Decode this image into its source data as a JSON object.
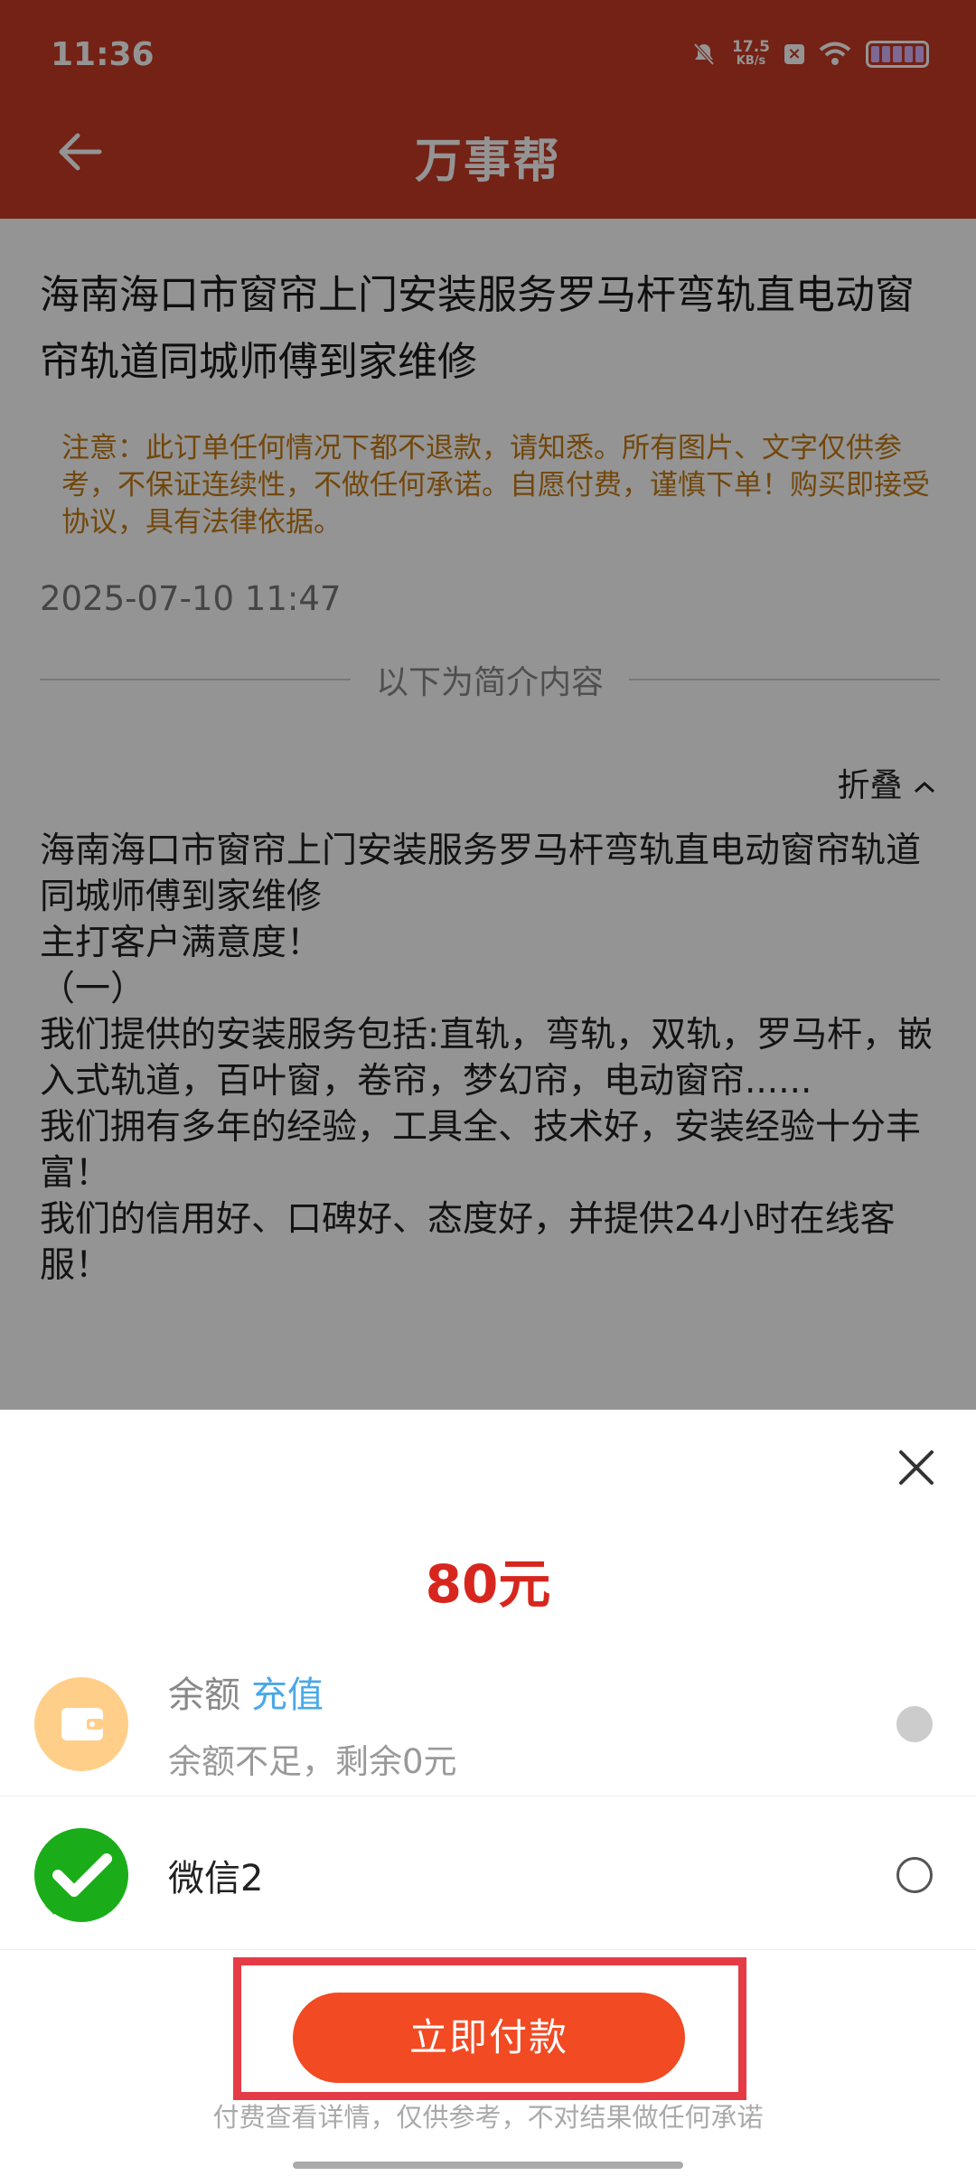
{
  "status": {
    "time": "11:36",
    "speed": "17.5",
    "speed_unit": "KB/s"
  },
  "header": {
    "title": "万事帮"
  },
  "article": {
    "title": "海南海口市窗帘上门安装服务罗马杆弯轨直电动窗帘轨道同城师傅到家维修",
    "notice": "注意：此订单任何情况下都不退款，请知悉。所有图片、文字仅供参考，不保证连续性，不做任何承诺。自愿付费，谨慎下单！购买即接受协议，具有法律依据。",
    "date": "2025-07-10 11:47",
    "divider_text": "以下为简介内容",
    "fold_label": "折叠",
    "description": "海南海口市窗帘上门安装服务罗马杆弯轨直电动窗帘轨道同城师傅到家维修\n主打客户满意度！\n（一）\n我们提供的安装服务包括:直轨，弯轨，双轨，罗马杆，嵌入式轨道，百叶窗，卷帘，梦幻帘，电动窗帘......\n我们拥有多年的经验，工具全、技术好，安装经验十分丰富！\n我们的信用好、口碑好、态度好，并提供24小时在线客服！"
  },
  "payment": {
    "price": "80元",
    "balance": {
      "label": "余额",
      "recharge": "充值",
      "sub": "余额不足，剩余0元"
    },
    "wechat": {
      "label": "微信2"
    },
    "pay_button": "立即付款",
    "footnote": "付费查看详情，仅供参考，不对结果做任何承诺"
  },
  "colors": {
    "brand": "#c63b25",
    "price": "#d7261d",
    "button": "#f24a23",
    "highlight": "#e53b47"
  }
}
